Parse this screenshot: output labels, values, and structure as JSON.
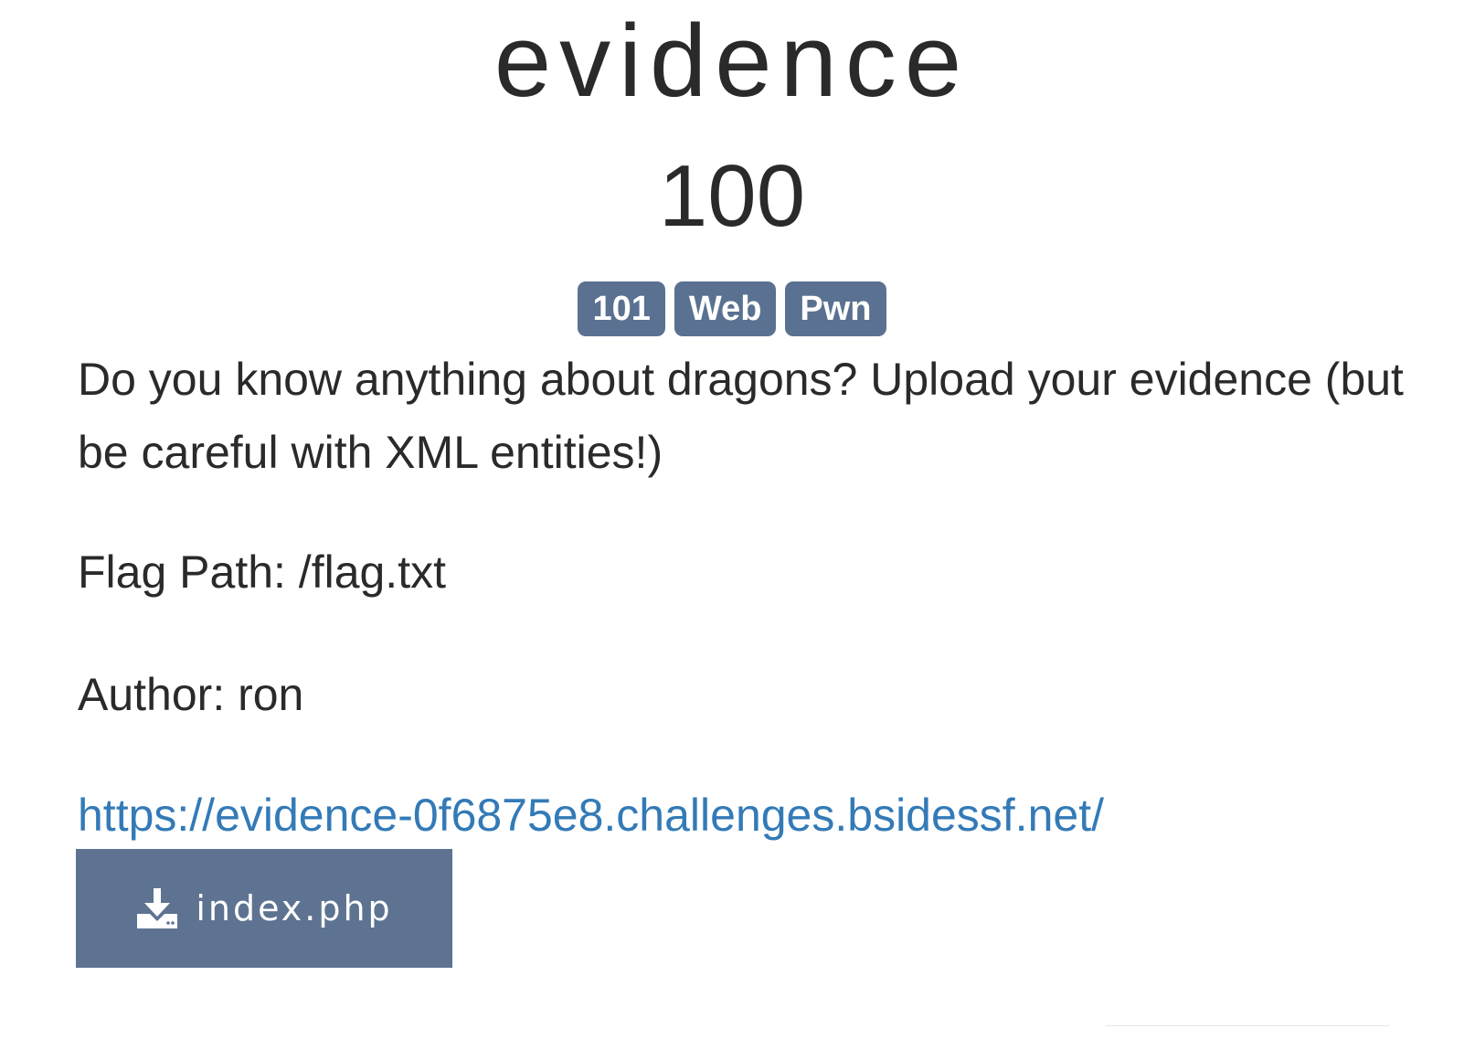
{
  "challenge": {
    "title": "evidence",
    "points": "100",
    "tags": [
      "101",
      "Web",
      "Pwn"
    ],
    "description": "Do you know anything about dragons? Upload your evidence (but be careful with XML entities!)",
    "flag_path": "Flag Path: /flag.txt",
    "author": "Author: ron",
    "url": "https://evidence-0f6875e8.challenges.bsidessf.net/",
    "download": {
      "label": "index.php",
      "icon": "download-icon"
    }
  },
  "colors": {
    "tag_bg": "#5a7191",
    "button_bg": "#5d7391",
    "link": "#337ab7",
    "text": "#2a2a2a"
  }
}
